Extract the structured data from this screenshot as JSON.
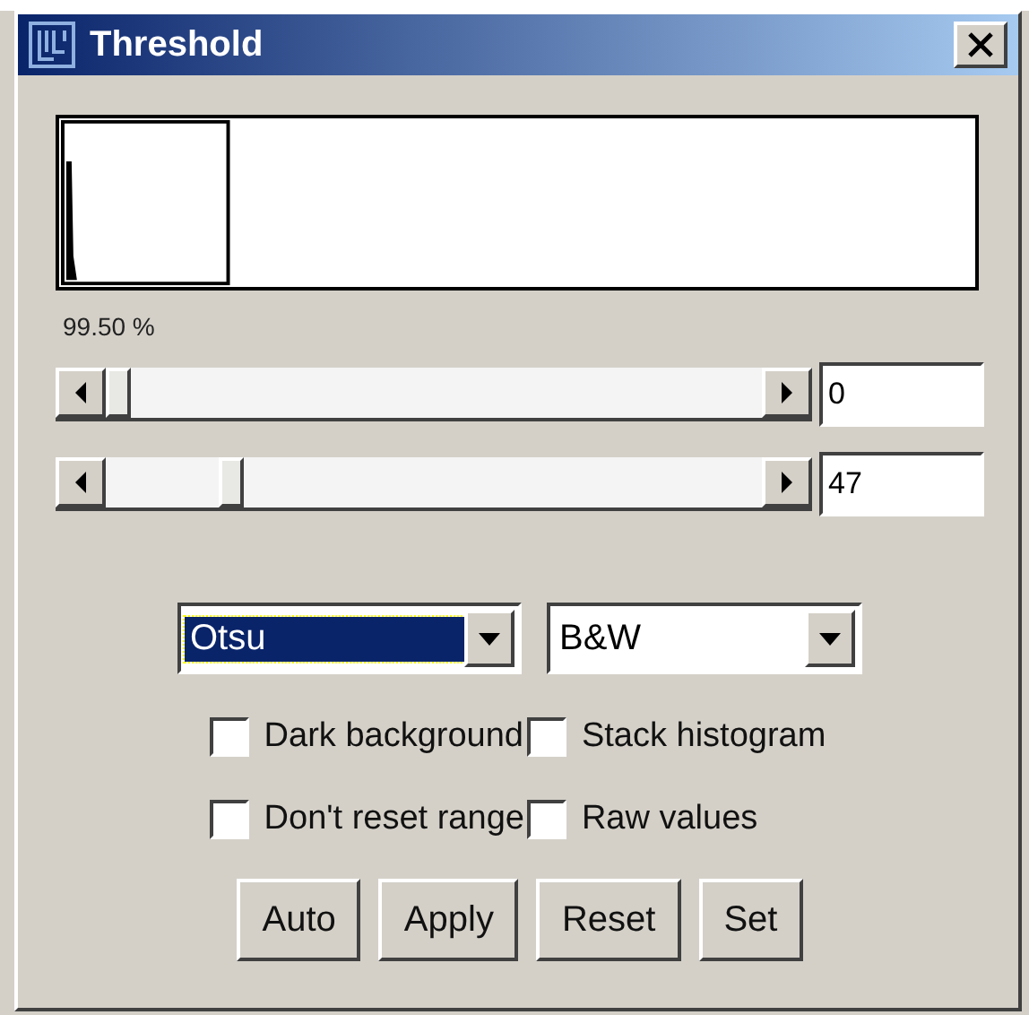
{
  "window": {
    "title": "Threshold"
  },
  "histogram": {
    "percent": "99.50 %"
  },
  "sliders": [
    {
      "level": 0,
      "value": "0"
    },
    {
      "level": 0.18,
      "value": "47"
    }
  ],
  "dropdowns": [
    {
      "value": "Otsu",
      "focused": true
    },
    {
      "value": "B&W",
      "focused": false
    }
  ],
  "checkboxes": [
    {
      "label": "Dark background",
      "checked": false
    },
    {
      "label": "Stack histogram",
      "checked": false
    },
    {
      "label": "Don't reset range",
      "checked": false
    },
    {
      "label": "Raw values",
      "checked": false
    }
  ],
  "buttons": [
    "Auto",
    "Apply",
    "Reset",
    "Set"
  ]
}
